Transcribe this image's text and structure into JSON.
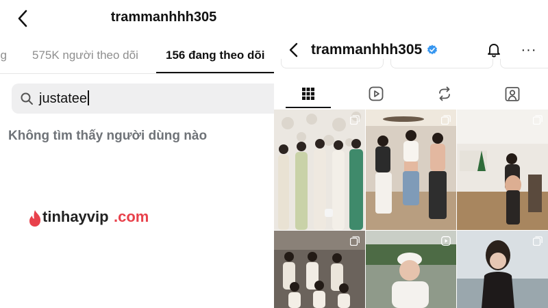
{
  "left_panel": {
    "title": "trammanhhh305",
    "tabs": [
      "ng",
      "575K người theo dõi",
      "156 đang theo dõi"
    ],
    "search_value": "justatee",
    "empty_message": "Không tìm thấy người dùng nào",
    "watermark": {
      "part1": "tinhayvip",
      "part2": ".com"
    }
  },
  "right_panel": {
    "username": "trammanhhh305",
    "more_glyph": "···",
    "grid_tabs": [
      "grid-icon",
      "reels-icon",
      "reposts-icon",
      "tagged-icon"
    ],
    "posts": [
      {
        "type": "carousel"
      },
      {
        "type": "carousel"
      },
      {
        "type": "carousel"
      },
      {
        "type": "carousel"
      },
      {
        "type": "reel"
      },
      {
        "type": "carousel"
      }
    ]
  }
}
